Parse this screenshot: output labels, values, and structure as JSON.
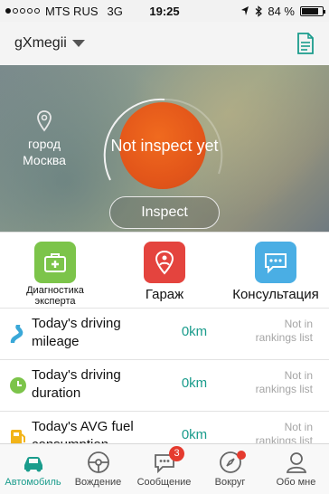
{
  "status_bar": {
    "carrier": "MTS RUS",
    "network": "3G",
    "time": "19:25",
    "battery": "84 %",
    "battery_level": 0.84
  },
  "header": {
    "user": "gXmegii"
  },
  "hero": {
    "city": "город Москва",
    "status": "Not inspect yet",
    "inspect_label": "Inspect"
  },
  "actions": [
    {
      "label": "Диагностика эксперта",
      "icon": "medkit-icon",
      "color": "#7cc44a"
    },
    {
      "label": "Гараж",
      "icon": "garage-icon",
      "color": "#e4443e"
    },
    {
      "label": "Консультация",
      "icon": "chat-icon",
      "color": "#4aaee4"
    }
  ],
  "stats": [
    {
      "label": "Today's driving mileage",
      "value": "0km",
      "rank": "Not in rankings list",
      "icon": "road-icon",
      "color": "#3aa8d8"
    },
    {
      "label": "Today's driving duration",
      "value": "0km",
      "rank": "Not in rankings list",
      "icon": "clock-icon",
      "color": "#7cc44a"
    },
    {
      "label": "Today's AVG fuel consumption",
      "value": "0km",
      "rank": "Not in rankings list",
      "icon": "fuel-icon",
      "color": "#f2b418"
    }
  ],
  "tabs": [
    {
      "label": "Автомобиль",
      "icon": "car-icon",
      "active": true
    },
    {
      "label": "Вождение",
      "icon": "steering-wheel-icon"
    },
    {
      "label": "Сообщение",
      "icon": "message-icon",
      "badge": "3"
    },
    {
      "label": "Вокруг",
      "icon": "compass-icon"
    },
    {
      "label": "Обо мне",
      "icon": "person-icon"
    }
  ],
  "colors": {
    "accent": "#1a9c8c",
    "inspect_orange": "#e3561a",
    "badge_red": "#e53b2f"
  }
}
